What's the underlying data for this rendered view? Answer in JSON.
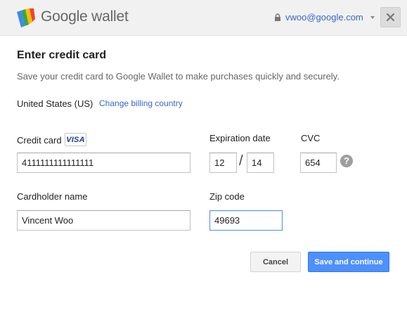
{
  "header": {
    "logo_text": "Google wallet",
    "account_email": "vwoo@google.com"
  },
  "form": {
    "title": "Enter credit card",
    "subtitle": "Save your credit card to Google Wallet to make purchases quickly and securely.",
    "country": "United States (US)",
    "change_country_link": "Change billing country",
    "credit_card": {
      "label": "Credit card",
      "brand": "VISA",
      "value": "4111111111111111"
    },
    "expiration": {
      "label": "Expiration date",
      "month": "12",
      "year": "14",
      "separator": "/"
    },
    "cvc": {
      "label": "CVC",
      "value": "654",
      "help": "?"
    },
    "cardholder": {
      "label": "Cardholder name",
      "value": "Vincent Woo"
    },
    "zip": {
      "label": "Zip code",
      "value": "49693"
    }
  },
  "buttons": {
    "cancel": "Cancel",
    "save": "Save and continue"
  },
  "colors": {
    "header_bg": "#f1f1f1",
    "link": "#3a66c6",
    "primary_button": "#4d90fe",
    "focus_border": "#4d90fe"
  }
}
